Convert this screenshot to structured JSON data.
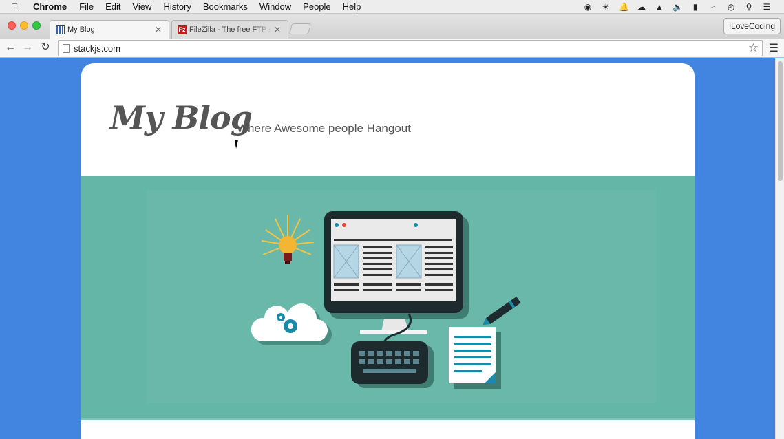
{
  "menubar": {
    "app": "Chrome",
    "items": [
      "File",
      "Edit",
      "View",
      "History",
      "Bookmarks",
      "Window",
      "People",
      "Help"
    ]
  },
  "tabs": [
    {
      "title": "My Blog",
      "icon": "grid-favicon-icon",
      "active": true
    },
    {
      "title": "FileZilla - The free FTP solution",
      "icon": "filezilla-favicon-icon",
      "active": false
    }
  ],
  "profile_button": "iLoveCoding",
  "address_bar": {
    "url": "stackjs.com"
  },
  "page": {
    "brand": "My Blog",
    "tagline": "Where Awesome people Hangout"
  },
  "colors": {
    "page_background": "#4285e0",
    "hero_background": "#64b6a6"
  }
}
